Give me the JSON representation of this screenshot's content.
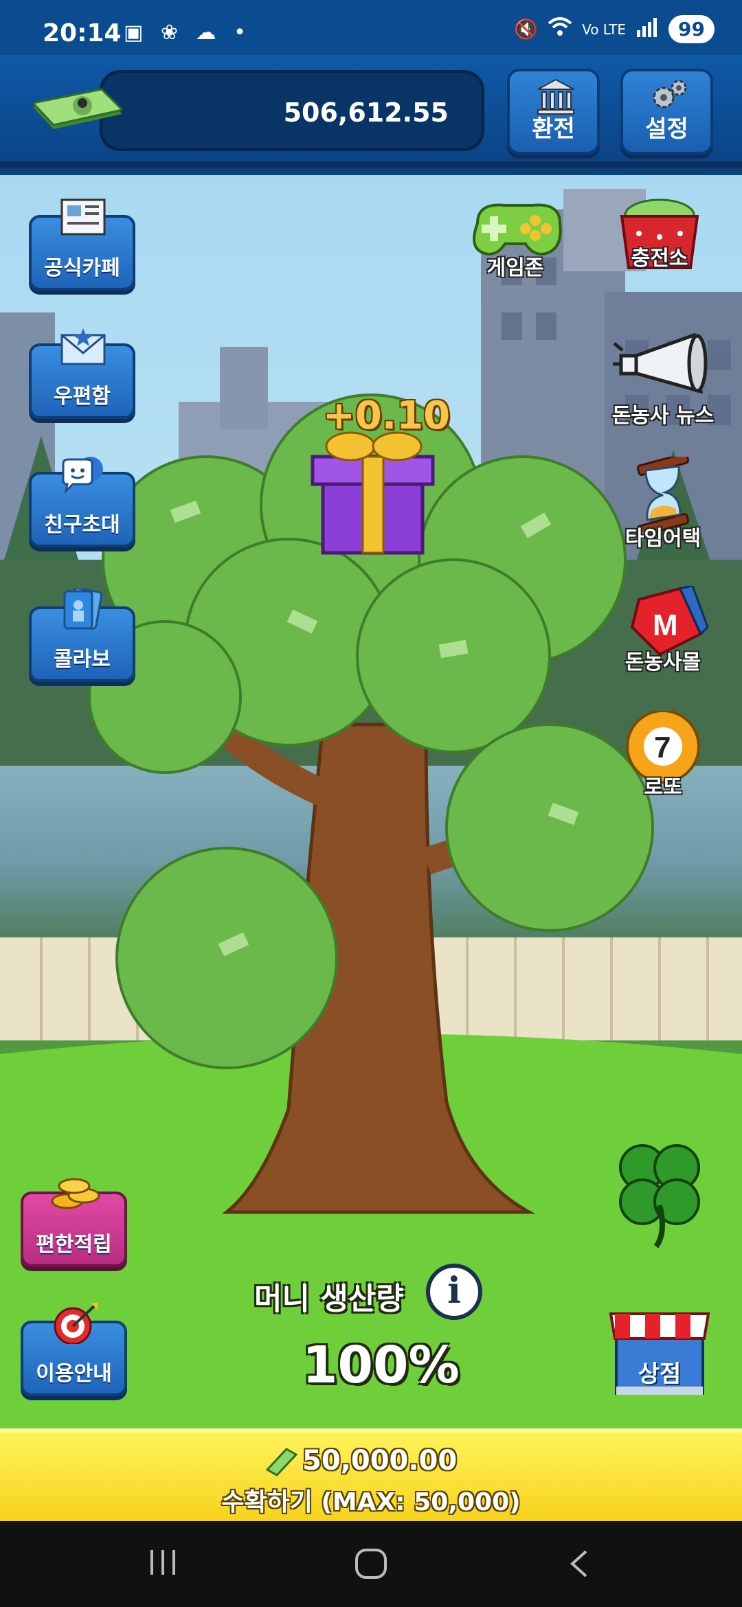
{
  "status_bar": {
    "time": "20:14",
    "left_icons": "▣ ❀ ☁ •",
    "network": "Vo LTE",
    "battery": "99"
  },
  "header": {
    "balance": "506,612.55",
    "exchange_label": "환전",
    "settings_label": "설정"
  },
  "left_menu": {
    "cafe": "공식카페",
    "mailbox": "우편함",
    "invite": "친구초대",
    "collab": "콜라보"
  },
  "right_menu": {
    "game_zone": "게임존",
    "charging_station": "충전소",
    "news": "돈농사 뉴스",
    "time_attack": "타임어택",
    "mall": "돈농사몰",
    "lotto": "로또"
  },
  "tree": {
    "gain": "+0.10"
  },
  "bottom_left": {
    "easy_earn": "편한적립",
    "guide": "이용안내"
  },
  "production": {
    "label": "머니 생산량",
    "value": "100%"
  },
  "shop_label": "상점",
  "harvest": {
    "amount": "50,000.00",
    "label": "수확하기 (MAX: 50,000)"
  },
  "colors": {
    "header_blue": "#0f5aa7",
    "harvest_yellow": "#f6d21c",
    "gain_gold": "#f7c54a"
  }
}
